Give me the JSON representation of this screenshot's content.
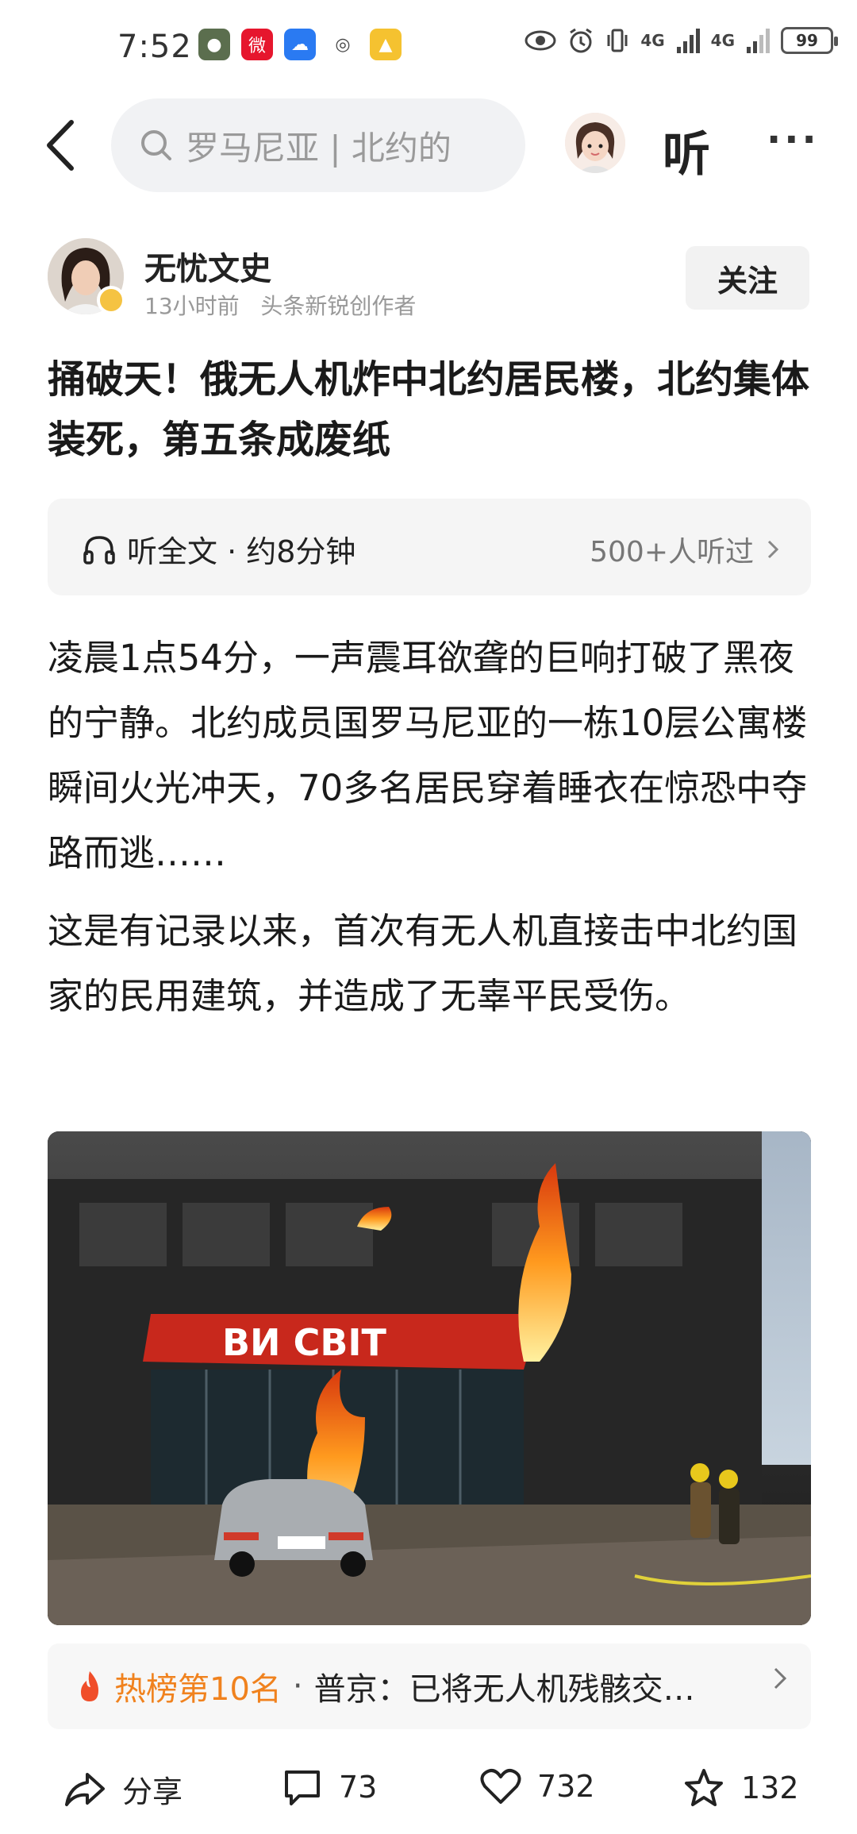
{
  "status_bar": {
    "time": "7:52",
    "battery": "99",
    "signal_1": "4G",
    "signal_2": "4G"
  },
  "nav": {
    "search_placeholder": "罗马尼亚 | 北约的",
    "listen_label": "听"
  },
  "author": {
    "name": "无忧文史",
    "time": "13小时前",
    "role": "头条新锐创作者",
    "follow_label": "关注"
  },
  "article": {
    "title": "捅破天！俄无人机炸中北约居民楼，北约集体装死，第五条成废纸",
    "listen_bar": {
      "label": "听全文 · 约8分钟",
      "count": "500+人听过"
    },
    "paragraphs": [
      "凌晨1点54分，一声震耳欲聋的巨响打破了黑夜的宁静。北约成员国罗马尼亚的一栋10层公寓楼瞬间火光冲天，70多名居民穿着睡衣在惊恐中夺路而逃……",
      "这是有记录以来，首次有无人机直接击中北约国家的民用建筑，并造成了无辜平民受伤。"
    ],
    "photo_sign": "ВИ    СВІТ"
  },
  "hot": {
    "rank": "热榜第10名",
    "separator": "·",
    "text": "普京：已将无人机残骸交…"
  },
  "actions": {
    "share": "分享",
    "comments": "73",
    "likes": "732",
    "favorites": "132"
  },
  "colors": {
    "hot_orange": "#f0821e",
    "flame_red": "#f04e2a"
  }
}
